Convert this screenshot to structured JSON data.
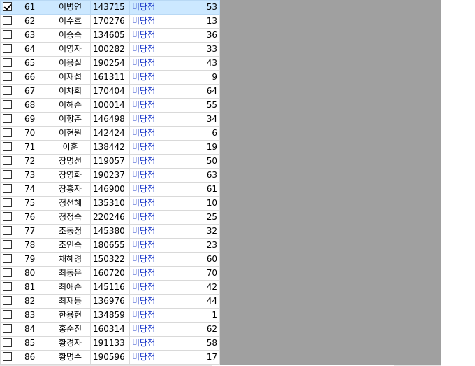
{
  "rows": [
    {
      "no": "61",
      "name": "이병연",
      "id": "143715",
      "result": "비당첨",
      "count": "53",
      "checked": true
    },
    {
      "no": "62",
      "name": "이수호",
      "id": "170276",
      "result": "비당첨",
      "count": "13",
      "checked": false
    },
    {
      "no": "63",
      "name": "이승숙",
      "id": "134605",
      "result": "비당첨",
      "count": "36",
      "checked": false
    },
    {
      "no": "64",
      "name": "이영자",
      "id": "100282",
      "result": "비당첨",
      "count": "33",
      "checked": false
    },
    {
      "no": "65",
      "name": "이응실",
      "id": "190254",
      "result": "비당첨",
      "count": "43",
      "checked": false
    },
    {
      "no": "66",
      "name": "이재섭",
      "id": "161311",
      "result": "비당첨",
      "count": "9",
      "checked": false
    },
    {
      "no": "67",
      "name": "이차희",
      "id": "170404",
      "result": "비당첨",
      "count": "64",
      "checked": false
    },
    {
      "no": "68",
      "name": "이해순",
      "id": "100014",
      "result": "비당첨",
      "count": "55",
      "checked": false
    },
    {
      "no": "69",
      "name": "이향춘",
      "id": "146498",
      "result": "비당첨",
      "count": "34",
      "checked": false
    },
    {
      "no": "70",
      "name": "이현원",
      "id": "142424",
      "result": "비당첨",
      "count": "6",
      "checked": false
    },
    {
      "no": "71",
      "name": "이훈",
      "id": "138442",
      "result": "비당첨",
      "count": "19",
      "checked": false
    },
    {
      "no": "72",
      "name": "장명선",
      "id": "119057",
      "result": "비당첨",
      "count": "50",
      "checked": false
    },
    {
      "no": "73",
      "name": "장영화",
      "id": "190237",
      "result": "비당첨",
      "count": "63",
      "checked": false
    },
    {
      "no": "74",
      "name": "장흥자",
      "id": "146900",
      "result": "비당첨",
      "count": "61",
      "checked": false
    },
    {
      "no": "75",
      "name": "정선혜",
      "id": "135310",
      "result": "비당첨",
      "count": "10",
      "checked": false
    },
    {
      "no": "76",
      "name": "정정숙",
      "id": "220246",
      "result": "비당첨",
      "count": "25",
      "checked": false
    },
    {
      "no": "77",
      "name": "조동정",
      "id": "145380",
      "result": "비당첨",
      "count": "32",
      "checked": false
    },
    {
      "no": "78",
      "name": "조인숙",
      "id": "180655",
      "result": "비당첨",
      "count": "23",
      "checked": false
    },
    {
      "no": "79",
      "name": "채혜경",
      "id": "150322",
      "result": "비당첨",
      "count": "60",
      "checked": false
    },
    {
      "no": "80",
      "name": "최동운",
      "id": "160720",
      "result": "비당첨",
      "count": "70",
      "checked": false
    },
    {
      "no": "81",
      "name": "최애순",
      "id": "145116",
      "result": "비당첨",
      "count": "42",
      "checked": false
    },
    {
      "no": "82",
      "name": "최재동",
      "id": "136976",
      "result": "비당첨",
      "count": "44",
      "checked": false
    },
    {
      "no": "83",
      "name": "한용현",
      "id": "134859",
      "result": "비당첨",
      "count": "1",
      "checked": false
    },
    {
      "no": "84",
      "name": "홍순진",
      "id": "160314",
      "result": "비당첨",
      "count": "62",
      "checked": false
    },
    {
      "no": "85",
      "name": "황경자",
      "id": "191133",
      "result": "비당첨",
      "count": "58",
      "checked": false
    },
    {
      "no": "86",
      "name": "황명수",
      "id": "190596",
      "result": "비당첨",
      "count": "17",
      "checked": false
    }
  ]
}
